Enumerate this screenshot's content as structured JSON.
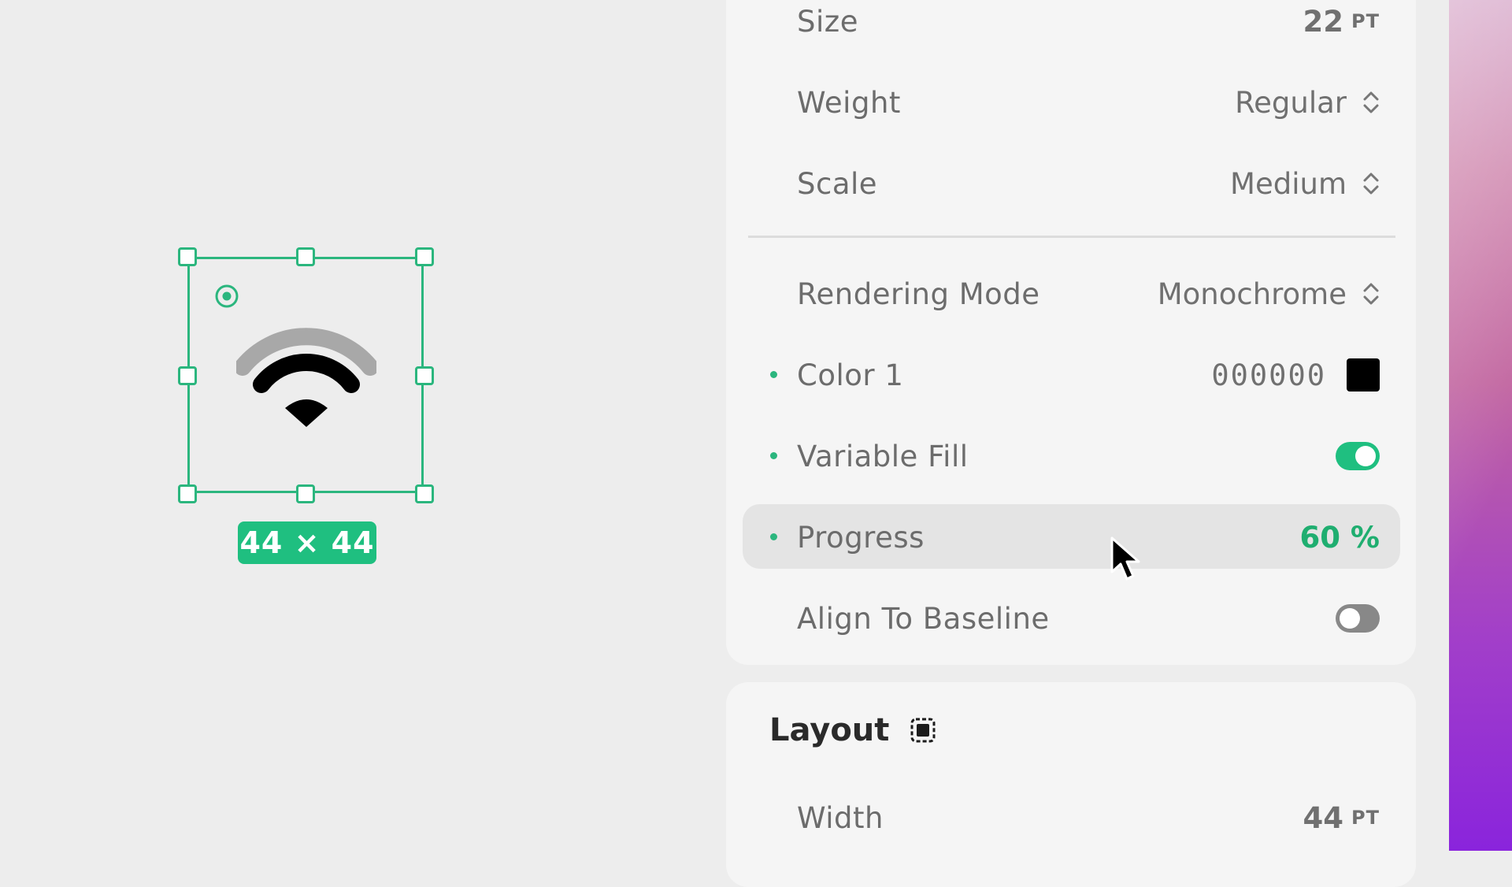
{
  "canvas": {
    "selected_symbol": "wifi",
    "dimension_badge": "44 × 44"
  },
  "inspector": {
    "size": {
      "label": "Size",
      "value": "22",
      "unit": "PT"
    },
    "weight": {
      "label": "Weight",
      "value": "Regular"
    },
    "scale": {
      "label": "Scale",
      "value": "Medium"
    },
    "rendering_mode": {
      "label": "Rendering Mode",
      "value": "Monochrome"
    },
    "color1": {
      "label": "Color 1",
      "value": "000000",
      "swatch": "#000000"
    },
    "variable_fill": {
      "label": "Variable Fill",
      "on": true
    },
    "progress": {
      "label": "Progress",
      "value": "60 %"
    },
    "align_baseline": {
      "label": "Align To Baseline",
      "on": false
    }
  },
  "layout": {
    "title": "Layout",
    "width": {
      "label": "Width",
      "value": "44",
      "unit": "PT"
    }
  },
  "colors": {
    "accent": "#1fbf80",
    "selection": "#2bb67e"
  },
  "icons": [
    "anchor-icon",
    "wifi-icon",
    "stepper-chevron-icon",
    "layout-frame-icon",
    "pointer-cursor-icon"
  ]
}
